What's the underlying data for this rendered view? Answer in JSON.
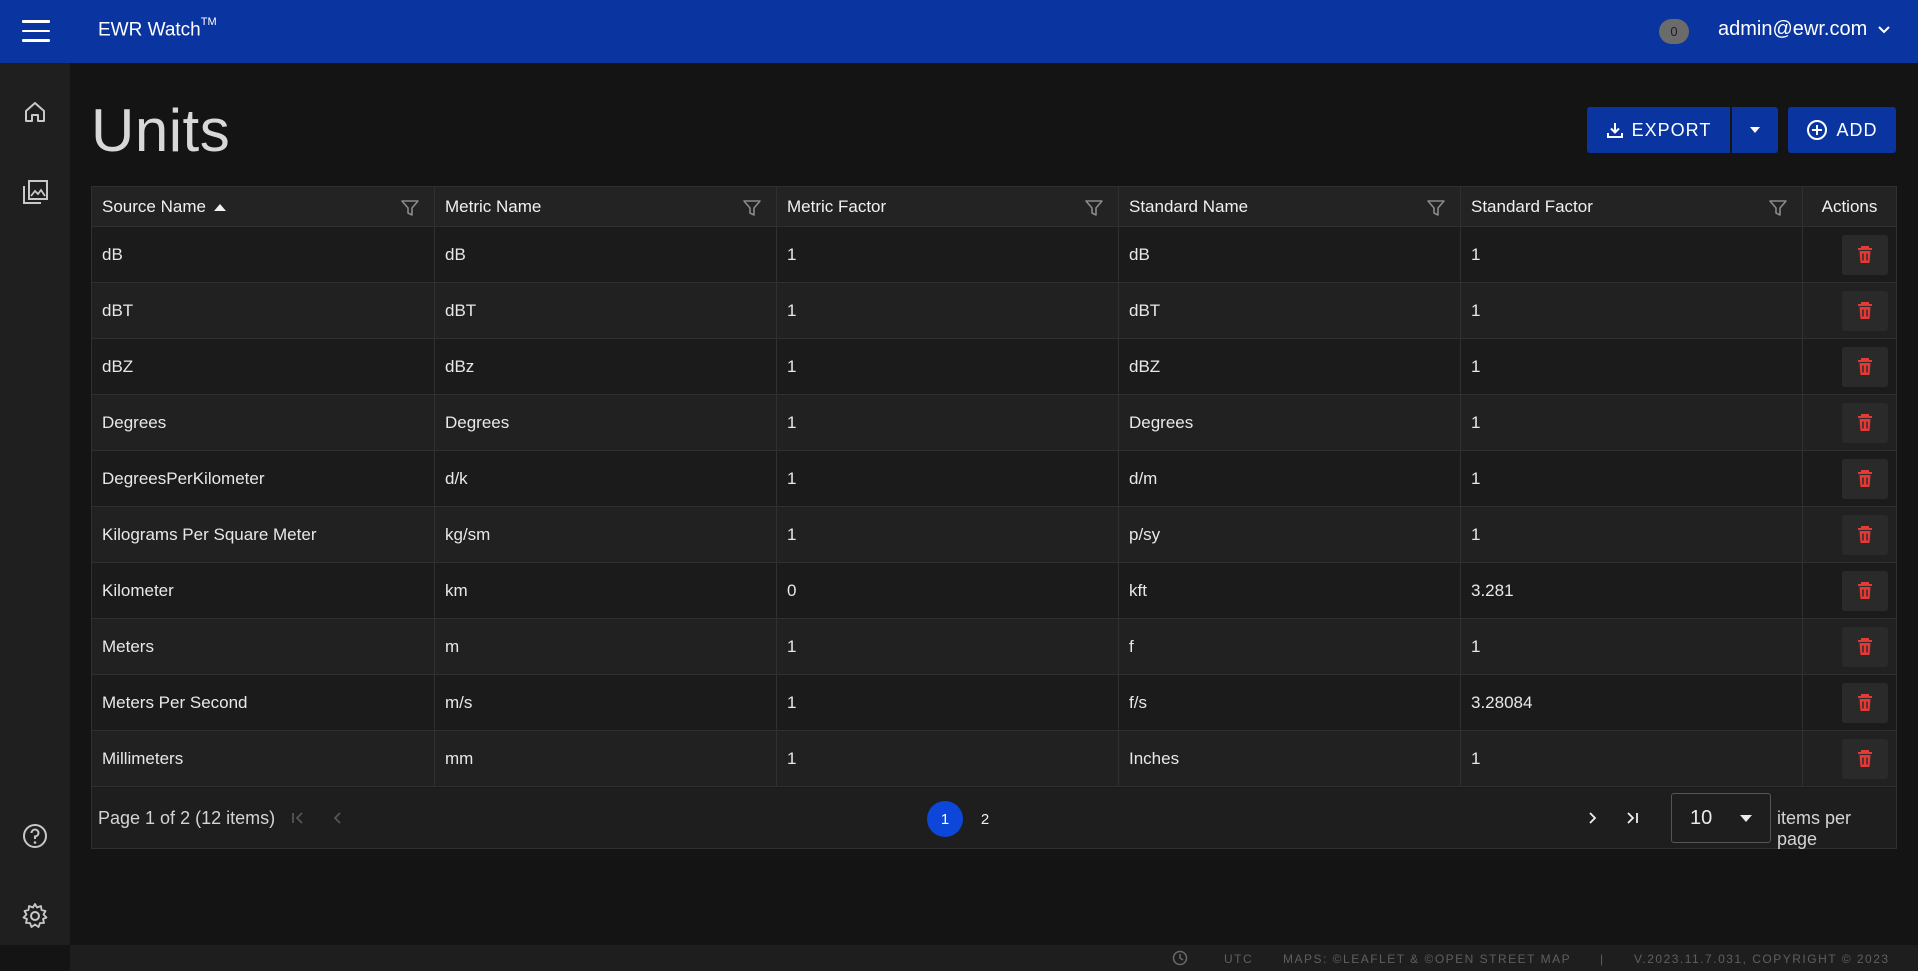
{
  "topbar": {
    "app_title": "EWR Watch",
    "trademark": "TM",
    "notification_count": "0",
    "user_email": "admin@ewr.com"
  },
  "page": {
    "title": "Units",
    "export_label": "EXPORT",
    "add_label": "ADD"
  },
  "table": {
    "columns": [
      "Source Name",
      "Metric Name",
      "Metric Factor",
      "Standard Name",
      "Standard Factor",
      "Actions"
    ],
    "sort_column": "Source Name",
    "sort_direction": "ascending",
    "rows": [
      [
        "dB",
        "dB",
        "1",
        "dB",
        "1"
      ],
      [
        "dBT",
        "dBT",
        "1",
        "dBT",
        "1"
      ],
      [
        "dBZ",
        "dBz",
        "1",
        "dBZ",
        "1"
      ],
      [
        "Degrees",
        "Degrees",
        "1",
        "Degrees",
        "1"
      ],
      [
        "DegreesPerKilometer",
        "d/k",
        "1",
        "d/m",
        "1"
      ],
      [
        "Kilograms Per Square Meter",
        "kg/sm",
        "1",
        "p/sy",
        "1"
      ],
      [
        "Kilometer",
        "km",
        "0",
        "kft",
        "3.281"
      ],
      [
        "Meters",
        "m",
        "1",
        "f",
        "1"
      ],
      [
        "Meters Per Second",
        "m/s",
        "1",
        "f/s",
        "3.28084"
      ],
      [
        "Millimeters",
        "mm",
        "1",
        "Inches",
        "1"
      ]
    ]
  },
  "pager": {
    "info": "Page 1 of 2 (12 items)",
    "pages": [
      "1",
      "2"
    ],
    "current_page": "1",
    "page_size": "10",
    "items_per_page_label": "items per page"
  },
  "footer": {
    "timezone": "UTC",
    "maps_credit": "MAPS: ©LEAFLET & ©OPEN STREET MAP",
    "separator": "|",
    "version": "V.2023.11.7.031, COPYRIGHT © 2023"
  },
  "colors": {
    "brand_blue": "#0a35a0",
    "active_page": "#0d47d9",
    "delete_red": "#e53935",
    "background": "#141414"
  },
  "icons": {
    "menu": "hamburger-icon",
    "home": "home-icon",
    "gallery": "image-gallery-icon",
    "help": "help-icon",
    "settings": "gear-icon",
    "export": "download-icon",
    "add": "plus-circle-icon",
    "filter": "filter-icon",
    "delete": "trash-icon",
    "clock": "clock-icon"
  }
}
